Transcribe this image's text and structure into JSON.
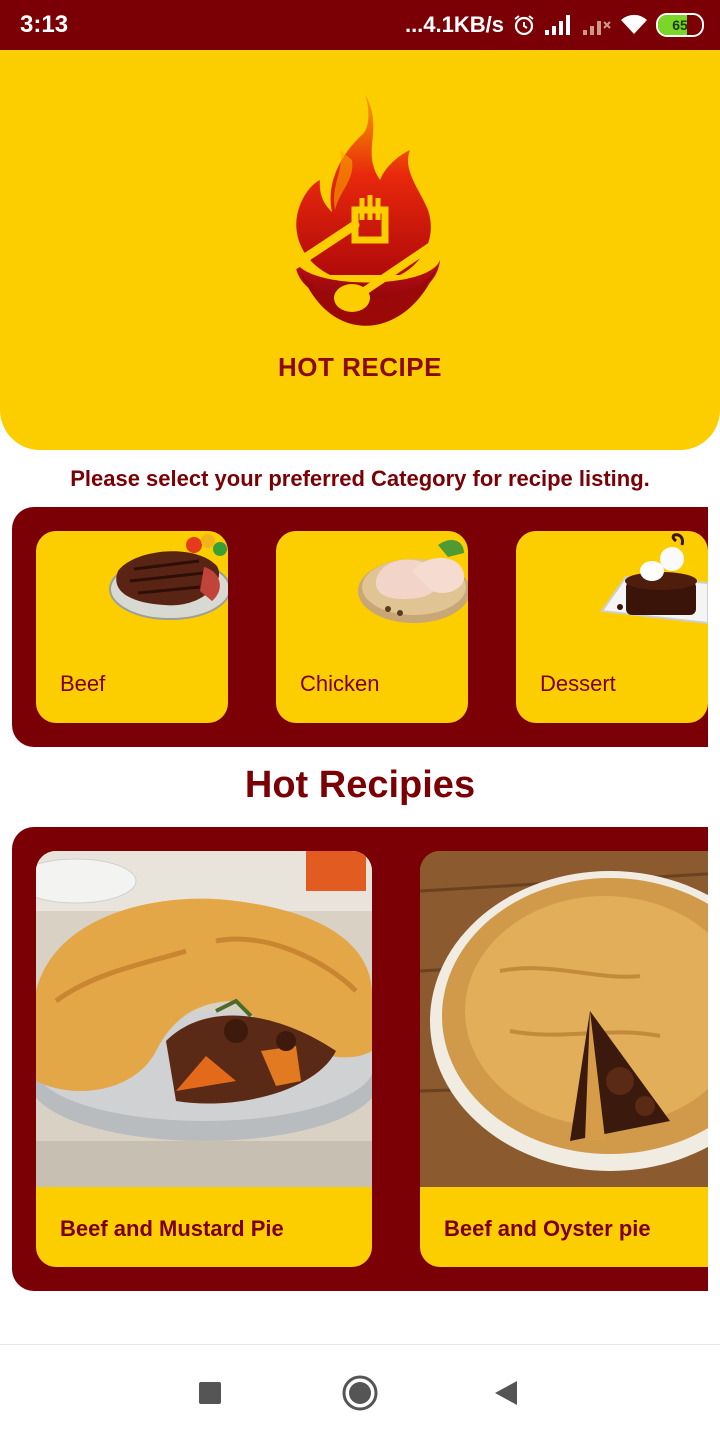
{
  "status_bar": {
    "time": "3:13",
    "net_speed": "...4.1KB/s",
    "battery": "65",
    "battery_level": 0.65,
    "icons": [
      "alarm-icon",
      "signal-icon",
      "signal-no-service-icon",
      "wifi-icon",
      "battery-icon"
    ]
  },
  "header": {
    "logo_icon": "flame-fork-spoon-logo",
    "logo_text": "HOT RECIPE",
    "background_color": "#fcce00"
  },
  "prompt": "Please select your preferred Category for recipe listing.",
  "categories": [
    {
      "label": "Beef",
      "image": "steak-image"
    },
    {
      "label": "Chicken",
      "image": "chicken-legs-image"
    },
    {
      "label": "Dessert",
      "image": "chocolate-cake-image"
    }
  ],
  "section_title": "Hot Recipies",
  "recipes": [
    {
      "label": "Beef and Mustard Pie",
      "image": "beef-pie-image"
    },
    {
      "label": "Beef and Oyster pie",
      "image": "oyster-pie-image"
    }
  ],
  "nav": {
    "icons": [
      "recents-square-icon",
      "home-circle-icon",
      "back-triangle-icon"
    ]
  },
  "colors": {
    "primary": "#7a0005",
    "accent": "#fcce00"
  }
}
